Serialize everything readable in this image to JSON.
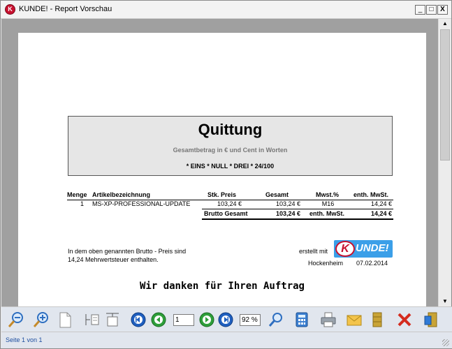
{
  "window": {
    "title": "KUNDE! - Report Vorschau",
    "app_icon_letter": "K",
    "buttons": {
      "minimize": "_",
      "maximize": "□",
      "close": "X"
    }
  },
  "receipt": {
    "title": "Quittung",
    "subtitle": "Gesamtbetrag in € und Cent in Worten",
    "amount_words": "* EINS * NULL * DREI * 24/100"
  },
  "table": {
    "headers": {
      "menge": "Menge",
      "artikel": "Artikelbezeichnung",
      "stk_preis": "Stk. Preis",
      "gesamt": "Gesamt",
      "mwst": "Mwst.%",
      "enth_mwst": "enth. MwSt."
    },
    "rows": [
      {
        "menge": "1",
        "artikel": "MS-XP-PROFESSIONAL-UPDATE",
        "stk_preis": "103,24 €",
        "gesamt": "103,24 €",
        "mwst": "M16",
        "enth_mwst": "14,24 €"
      }
    ],
    "total": {
      "label": "Brutto Gesamt",
      "gesamt": "103,24 €",
      "mwst_label": "enth. MwSt.",
      "enth_mwst": "14,24 €"
    }
  },
  "notes": {
    "line1": "In dem oben genannten Brutto - Preis sind",
    "line2": "14,24 Mehrwertsteuer enthalten.",
    "made_with": "erstellt mit",
    "logo_k": "K",
    "logo_text": "UNDE!",
    "place": "Hockenheim",
    "date": "07.02.2014",
    "thanks": "Wir danken für Ihren Auftrag"
  },
  "toolbar": {
    "page_value": "1",
    "zoom_value": "92 %",
    "icons": [
      "zoom-out-icon",
      "zoom-in-icon",
      "single-page-icon",
      "page-width-icon",
      "page-height-icon",
      "first-page-icon",
      "previous-page-icon",
      "next-page-icon",
      "last-page-icon",
      "search-icon",
      "calculator-icon",
      "printer-icon",
      "email-icon",
      "archive-icon",
      "close-icon",
      "exit-icon"
    ]
  },
  "status": {
    "text": "Seite 1 von 1"
  },
  "colors": {
    "brand_red": "#c8102e",
    "brand_blue": "#3b9fe8",
    "nav_blue": "#1f5fbf",
    "nav_green": "#2e9e3a"
  }
}
